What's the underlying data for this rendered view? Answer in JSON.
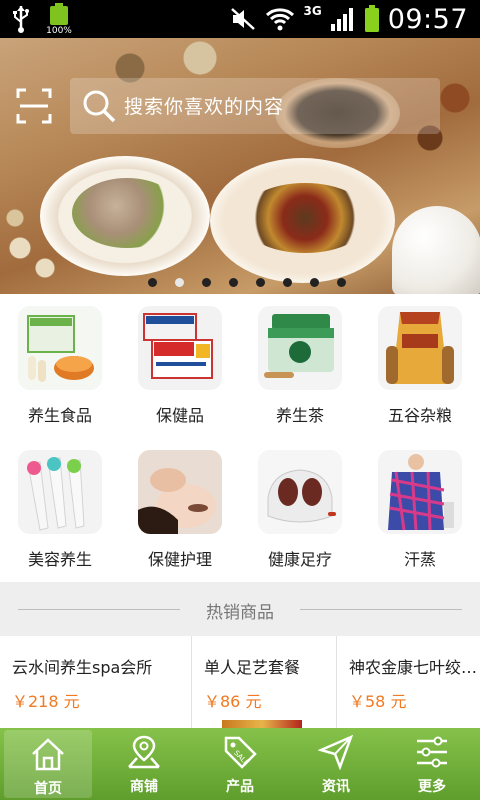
{
  "status_bar": {
    "battery_small_percent": "100%",
    "network": "3G",
    "time": "09:57"
  },
  "search": {
    "placeholder": "搜索你喜欢的内容"
  },
  "banner": {
    "slide_count": 8,
    "active_slide": 2
  },
  "categories": [
    {
      "label": "养生食品"
    },
    {
      "label": "保健品"
    },
    {
      "label": "养生茶"
    },
    {
      "label": "五谷杂粮"
    },
    {
      "label": "美容养生"
    },
    {
      "label": "保健护理"
    },
    {
      "label": "健康足疗"
    },
    {
      "label": "汗蒸"
    }
  ],
  "hot": {
    "title": "热销商品",
    "products": [
      {
        "name": "云水间养生spa会所",
        "price": "￥218 元"
      },
      {
        "name": "单人足艺套餐",
        "price": "￥86 元"
      },
      {
        "name": "神农金康七叶绞…",
        "price": "￥58 元"
      }
    ]
  },
  "nav": {
    "items": [
      {
        "label": "首页",
        "icon": "home-icon"
      },
      {
        "label": "商铺",
        "icon": "map-icon"
      },
      {
        "label": "产品",
        "icon": "tag-icon"
      },
      {
        "label": "资讯",
        "icon": "send-icon"
      },
      {
        "label": "更多",
        "icon": "sliders-icon"
      }
    ]
  },
  "colors": {
    "accent_green": "#6aab35",
    "price_orange": "#f07a23"
  }
}
